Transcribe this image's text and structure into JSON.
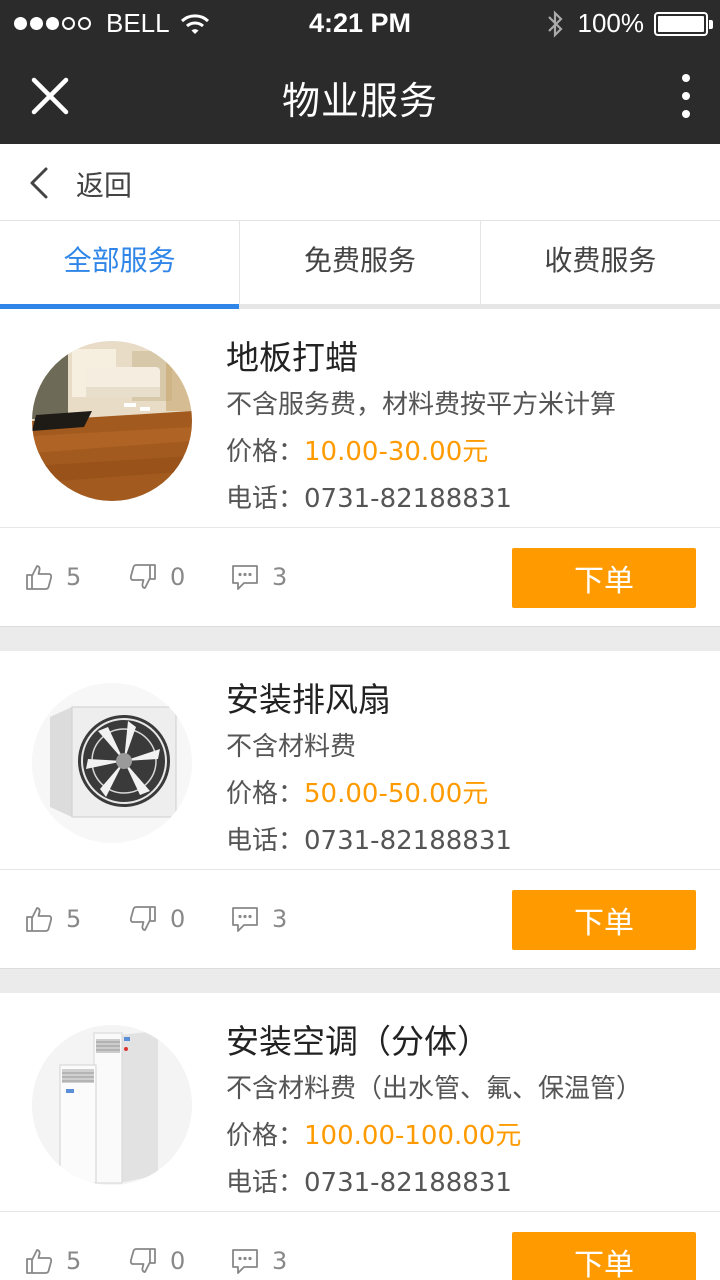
{
  "status_bar": {
    "carrier": "BELL",
    "time": "4:21 PM",
    "battery": "100%"
  },
  "nav": {
    "title": "物业服务"
  },
  "back": {
    "label": "返回"
  },
  "tabs": [
    {
      "label": "全部服务",
      "active": true
    },
    {
      "label": "免费服务",
      "active": false
    },
    {
      "label": "收费服务",
      "active": false
    }
  ],
  "services": [
    {
      "name": "地板打蜡",
      "desc": "不含服务费，材料费按平方米计算",
      "price_label": "价格：",
      "price": "10.00-30.00元",
      "phone_label": "电话：",
      "phone": "0731-82188831",
      "likes": "5",
      "dislikes": "0",
      "comments": "3",
      "order_label": "下单",
      "image_icon": "floor-room-photo"
    },
    {
      "name": "安装排风扇",
      "desc": "不含材料费",
      "price_label": "价格：",
      "price": "50.00-50.00元",
      "phone_label": "电话：",
      "phone": "0731-82188831",
      "likes": "5",
      "dislikes": "0",
      "comments": "3",
      "order_label": "下单",
      "image_icon": "exhaust-fan-photo"
    },
    {
      "name": "安装空调（分体）",
      "desc": "不含材料费（出水管、氟、保温管）",
      "price_label": "价格：",
      "price": "100.00-100.00元",
      "phone_label": "电话：",
      "phone": "0731-82188831",
      "likes": "5",
      "dislikes": "0",
      "comments": "3",
      "order_label": "下单",
      "image_icon": "air-conditioner-photo"
    }
  ],
  "colors": {
    "header_bg": "#2b2b2b",
    "accent_blue": "#2f86e8",
    "price_orange": "#ff9b00",
    "order_button": "#ff9b00"
  }
}
